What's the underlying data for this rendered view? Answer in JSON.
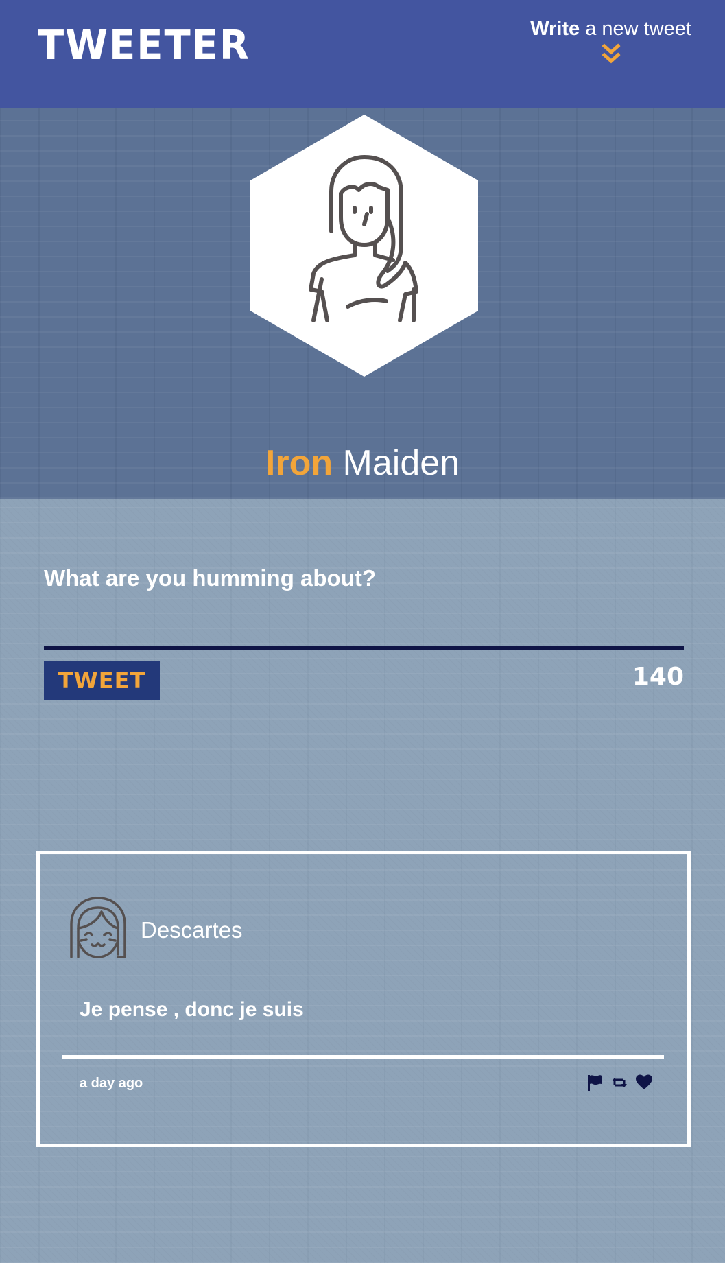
{
  "nav": {
    "brand": "TWEETER",
    "compose_toggle": {
      "strong": "Write",
      "light": " a new tweet",
      "arrow_icon": "double-chevron-down-icon"
    }
  },
  "profile": {
    "avatar_icon": "woman-avatar-icon",
    "first_name": "Iron",
    "last_name": " Maiden"
  },
  "compose": {
    "placeholder": "What are you humming about?",
    "value": "",
    "tweet_button": "TWEET",
    "counter": "140"
  },
  "tweets": [
    {
      "avatar_icon": "girl-smiling-avatar-icon",
      "author": "Descartes",
      "body": "Je pense , donc je suis",
      "time": "a day ago",
      "actions": [
        "flag-icon",
        "retweet-icon",
        "heart-icon"
      ]
    }
  ],
  "colors": {
    "nav_bg": "#4355a0",
    "accent": "#f2a53a",
    "button_bg": "#23397a",
    "divider_dark": "#0f1446",
    "icon_dark": "#0f1446",
    "profile_bg": "#5c7295",
    "page_bg": "#8ea3b8"
  }
}
